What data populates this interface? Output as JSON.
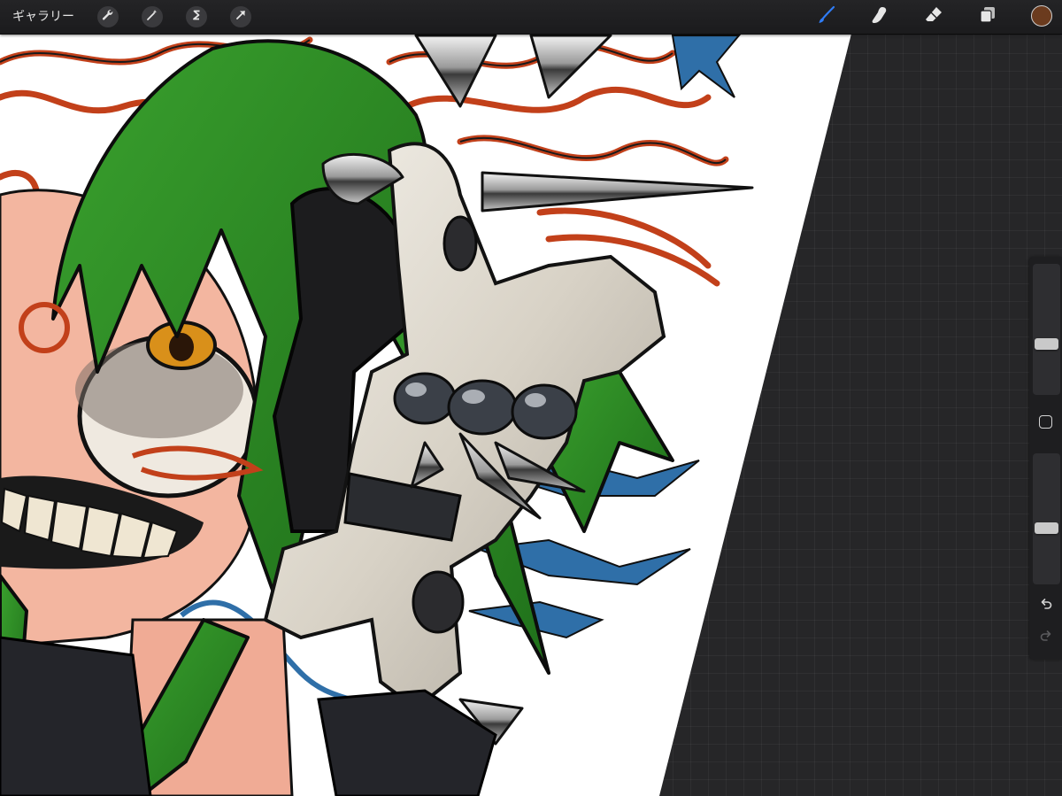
{
  "topbar": {
    "gallery_label": "ギャラリー",
    "left_tools": [
      {
        "name": "actions",
        "icon": "wrench-icon"
      },
      {
        "name": "adjustments",
        "icon": "magic-wand-icon"
      },
      {
        "name": "selection",
        "icon": "selection-s-icon"
      },
      {
        "name": "transform",
        "icon": "arrow-cursor-icon"
      }
    ],
    "right_tools": [
      {
        "name": "brush",
        "icon": "brush-icon",
        "active": true
      },
      {
        "name": "smudge",
        "icon": "smudge-finger-icon",
        "active": false
      },
      {
        "name": "eraser",
        "icon": "eraser-icon",
        "active": false
      },
      {
        "name": "layers",
        "icon": "layers-icon",
        "active": false
      }
    ],
    "current_color": "#6b3b1e"
  },
  "sidebar": {
    "brush_size_level": 0.38,
    "opacity_level": 0.42,
    "undo_icon": "undo-arrow-icon",
    "redo_icon": "redo-arrow-icon",
    "modify_icon": "square-modify-icon"
  },
  "colors": {
    "accent": "#2f7cf6",
    "canvas_bg": "#ffffff",
    "workspace": "#262628",
    "hair_green": "#2b8a22",
    "hair_red": "#c2401a",
    "skin": "#f3b6a0",
    "blue_bolt": "#2f6fa8"
  }
}
